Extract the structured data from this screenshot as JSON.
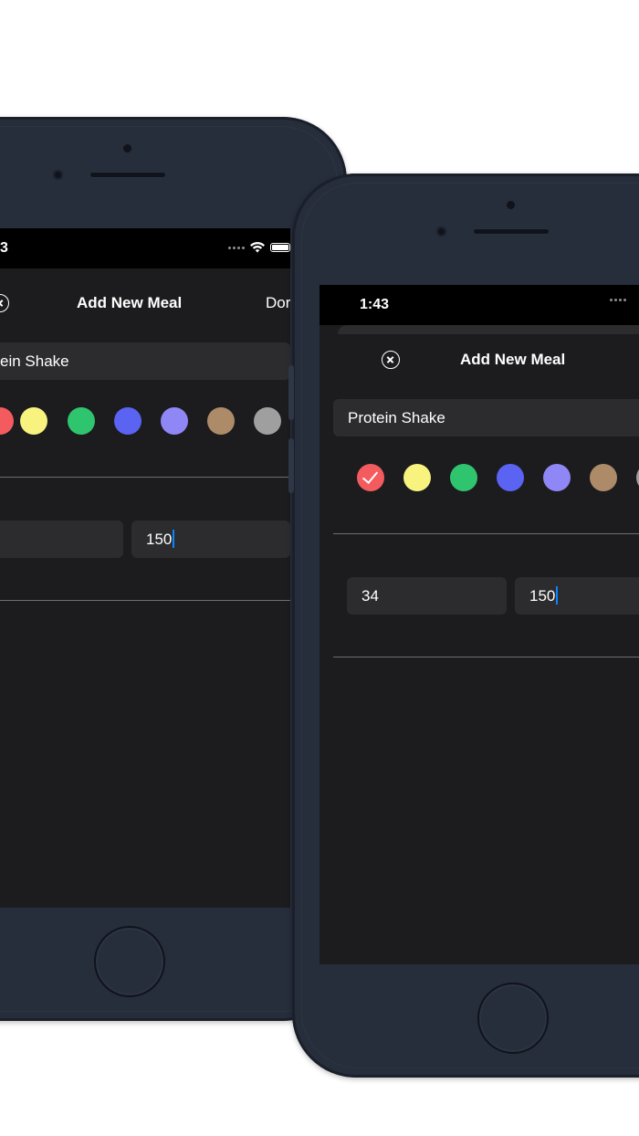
{
  "colors": {
    "phone_body": "#262d3b",
    "screen_bg": "#1c1c1e",
    "field_bg": "#2c2c2e",
    "caret": "#0a84ff"
  },
  "back_phone": {
    "status": {
      "time": "3"
    },
    "nav": {
      "title": "Add New Meal",
      "done_label": "Dor",
      "close_icon": "close-circle-icon"
    },
    "meal_name": {
      "value": "ein Shake"
    },
    "swatches": [
      {
        "color": "#f35b5e",
        "selected": false
      },
      {
        "color": "#f7f37e",
        "selected": false
      },
      {
        "color": "#2fc56f",
        "selected": false
      },
      {
        "color": "#5a63f2",
        "selected": false
      },
      {
        "color": "#9087f6",
        "selected": false
      },
      {
        "color": "#ad8b69",
        "selected": false
      },
      {
        "color": "#9f9f9f",
        "selected": false
      }
    ],
    "fields": {
      "first": "",
      "second": "150"
    }
  },
  "front_phone": {
    "status": {
      "time": "1:43"
    },
    "nav": {
      "title": "Add New Meal",
      "close_icon": "close-circle-icon"
    },
    "meal_name": {
      "value": "Protein Shake"
    },
    "swatches": [
      {
        "color": "#f35b5e",
        "selected": true
      },
      {
        "color": "#f7f37e",
        "selected": false
      },
      {
        "color": "#2fc56f",
        "selected": false
      },
      {
        "color": "#5a63f2",
        "selected": false
      },
      {
        "color": "#9087f6",
        "selected": false
      },
      {
        "color": "#ad8b69",
        "selected": false
      },
      {
        "color": "#9f9f9f",
        "selected": false
      }
    ],
    "fields": {
      "first": "34",
      "second": "150"
    }
  }
}
